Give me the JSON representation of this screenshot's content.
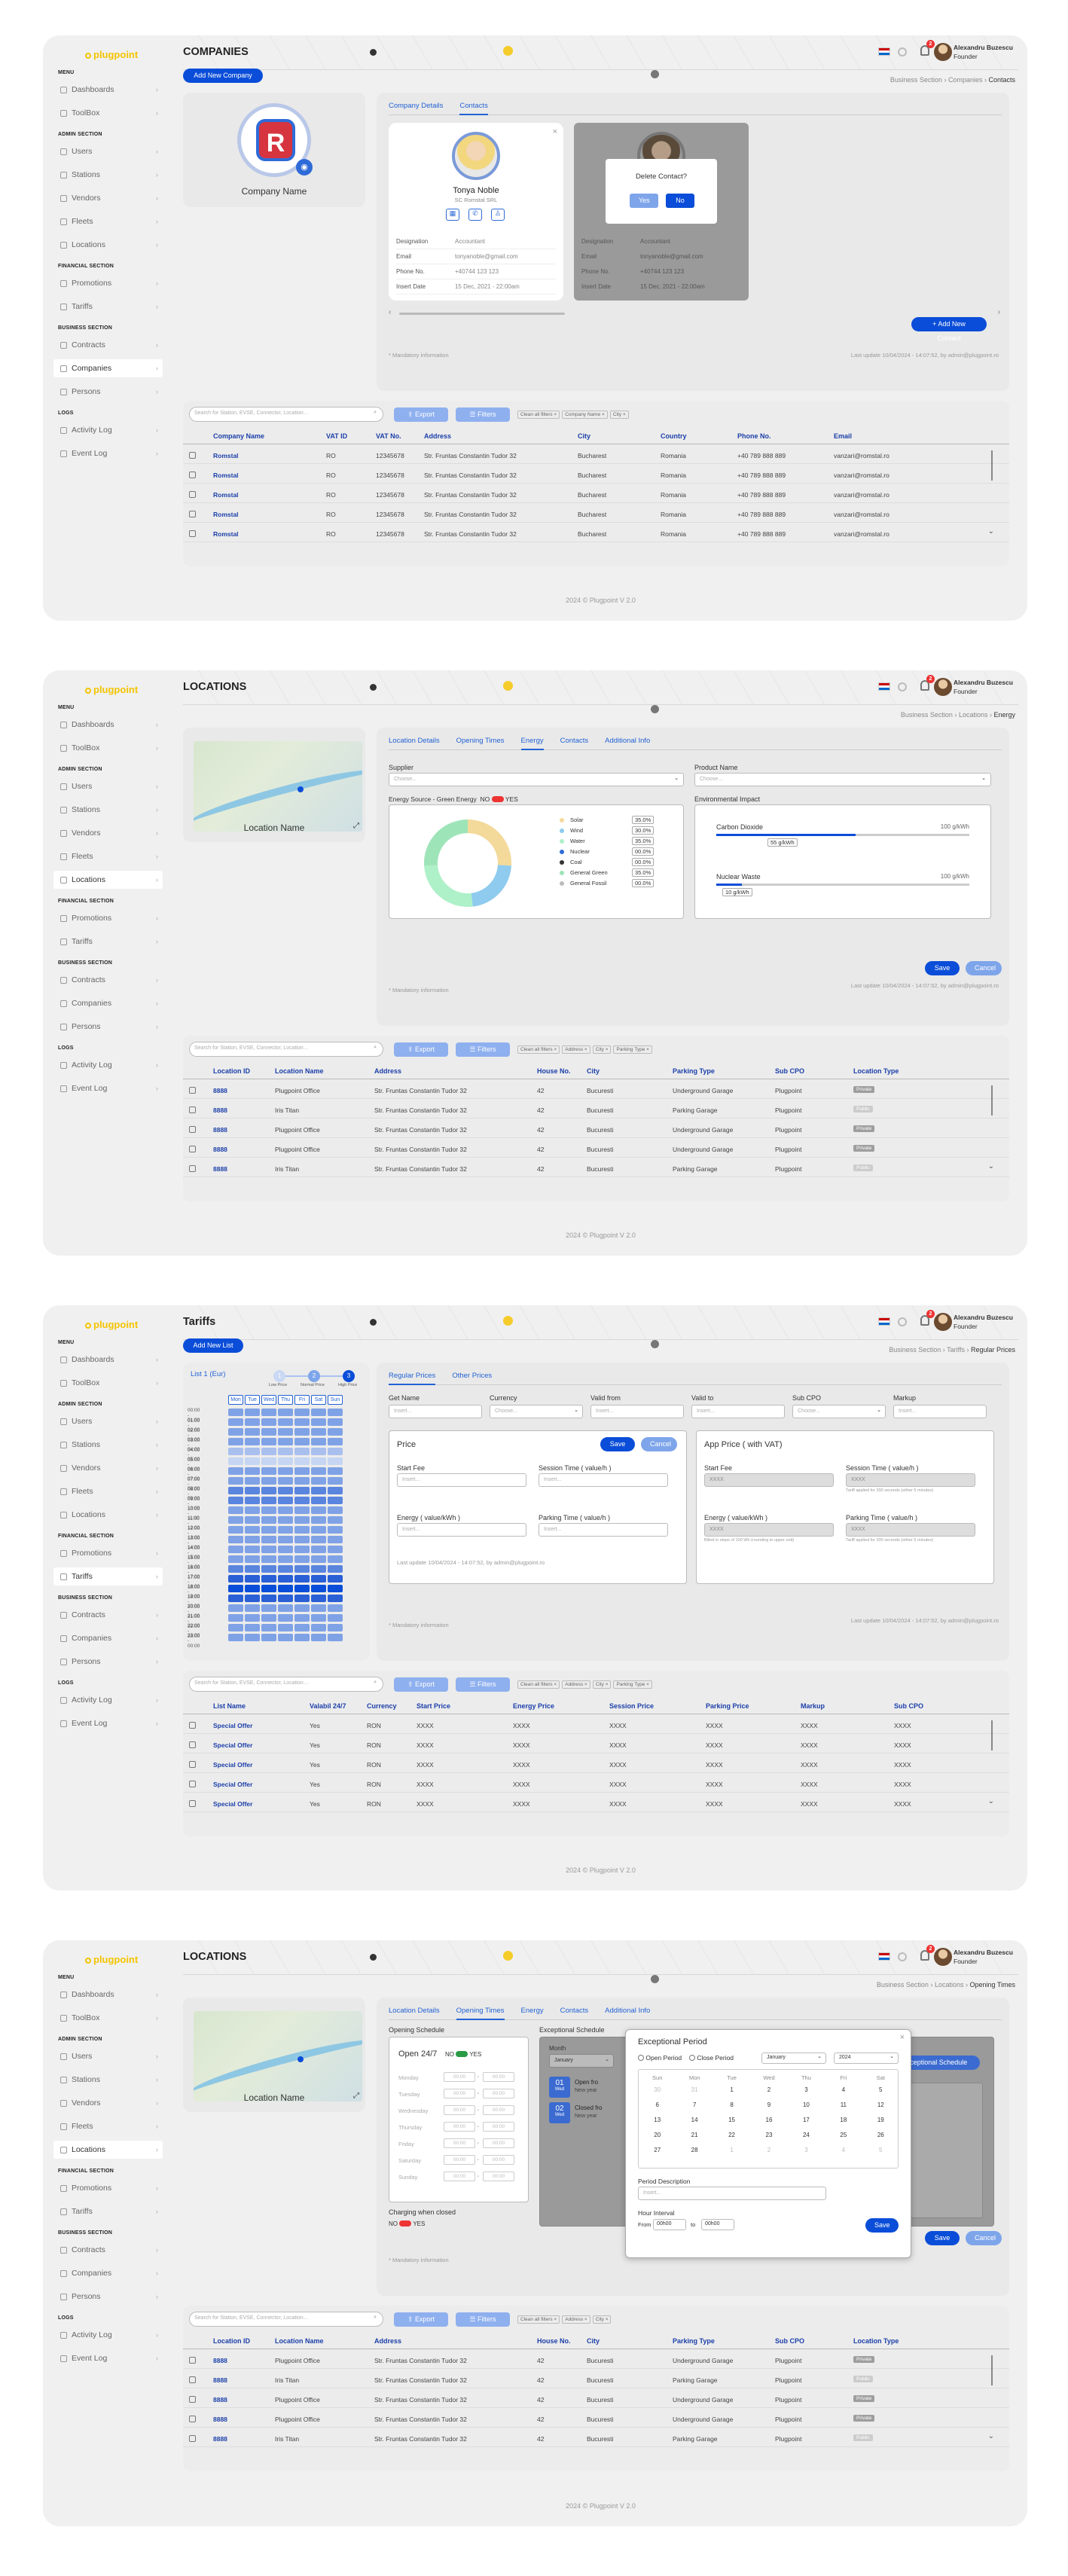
{
  "brand": "plugpoint",
  "user": {
    "name": "Alexandru Buzescu",
    "role": "Founder"
  },
  "notif_count": "2",
  "footer": "2024 © Plugpoint V 2.0",
  "sidebar": {
    "menu_header": "MENU",
    "dashboards": "Dashboards",
    "toolbox": "ToolBox",
    "admin_header": "ADMIN SECTION",
    "users": "Users",
    "stations": "Stations",
    "vendors": "Vendors",
    "fleets": "Fleets",
    "locations": "Locations",
    "financial_header": "FINANCIAL SECTION",
    "promotions": "Promotions",
    "tariffs": "Tariffs",
    "business_header": "BUSINESS SECTION",
    "contracts": "Contracts",
    "companies": "Companies",
    "persons": "Persons",
    "logs_header": "LOGS",
    "activity_log": "Activity Log",
    "event_log": "Event Log"
  },
  "screen1": {
    "title": "COMPANIES",
    "add_button": "Add New Company",
    "crumb": [
      "Business Section",
      "Companies",
      "Contacts"
    ],
    "company_name": "Company Name",
    "tabs": [
      "Company Details",
      "Contacts"
    ],
    "contact": {
      "name": "Tonya Noble",
      "company": "SC Romstal SRL",
      "fields": [
        [
          "Designation",
          "Accountant"
        ],
        [
          "Email",
          "tonyanoble@gmail.com"
        ],
        [
          "Phone No.",
          "+40744 123 123"
        ],
        [
          "Insert Date",
          "15 Dec, 2021 - 22:00am"
        ]
      ]
    },
    "delete_dialog": {
      "title": "Delete Contact?",
      "yes": "Yes",
      "no": "No"
    },
    "add_contact": "+ Add New Contact",
    "mandatory": "* Mandatory information",
    "last_update": "Last update 10/04/2024 - 14:07:52, by admin@plugpoint.ro",
    "search_placeholder": "Search for Station, EVSE, Connector, Location…",
    "export": "Export",
    "filters": "Filters",
    "chips": [
      "Clean all filters ×",
      "Company Name ×",
      "City ×"
    ],
    "columns": [
      "Company Name",
      "VAT ID",
      "VAT No.",
      "Address",
      "City",
      "Country",
      "Phone No.",
      "Email"
    ],
    "rows": [
      [
        "Romstal",
        "RO",
        "12345678",
        "Str. Fruntas Constantin Tudor 32",
        "Bucharest",
        "Romania",
        "+40 789 888 889",
        "vanzari@romstal.ro"
      ],
      [
        "Romstal",
        "RO",
        "12345678",
        "Str. Fruntas Constantin Tudor 32",
        "Bucharest",
        "Romania",
        "+40 789 888 889",
        "vanzari@romstal.ro"
      ],
      [
        "Romstal",
        "RO",
        "12345678",
        "Str. Fruntas Constantin Tudor 32",
        "Bucharest",
        "Romania",
        "+40 789 888 889",
        "vanzari@romstal.ro"
      ],
      [
        "Romstal",
        "RO",
        "12345678",
        "Str. Fruntas Constantin Tudor 32",
        "Bucharest",
        "Romania",
        "+40 789 888 889",
        "vanzari@romstal.ro"
      ],
      [
        "Romstal",
        "RO",
        "12345678",
        "Str. Fruntas Constantin Tudor 32",
        "Bucharest",
        "Romania",
        "+40 789 888 889",
        "vanzari@romstal.ro"
      ]
    ]
  },
  "screen2": {
    "title": "LOCATIONS",
    "crumb": [
      "Business Section",
      "Locations",
      "Energy"
    ],
    "location_name": "Location Name",
    "tabs": [
      "Location Details",
      "Opening Times",
      "Energy",
      "Contacts",
      "Additional Info"
    ],
    "supplier_label": "Supplier",
    "supplier_placeholder": "Choose...",
    "product_label": "Product Name",
    "product_placeholder": "Choose...",
    "energy_source": "Energy Source - Green Energy",
    "no": "NO",
    "yes": "YES",
    "legend": [
      [
        "Solar",
        "35.0%",
        "#f3d99a"
      ],
      [
        "Wind",
        "30.0%",
        "#8ecbee"
      ],
      [
        "Water",
        "35.0%",
        "#aef0c8"
      ],
      [
        "Nuclear",
        "00.0%",
        "#2f6bd8"
      ],
      [
        "Coal",
        "00.0%",
        "#333333"
      ],
      [
        "General Green",
        "35.0%",
        "#9ee4b9"
      ],
      [
        "General Fossil",
        "00.0%",
        "#bbbbbb"
      ]
    ],
    "env_label": "Environmental Impact",
    "carbon": {
      "label": "Carbon Dioxide",
      "max": "100 g/kWh",
      "value": "55 g/kWh",
      "fraction": 0.55
    },
    "waste": {
      "label": "Nuclear Waste",
      "max": "100 g/kWh",
      "value": "10 g/kWh",
      "fraction": 0.1
    },
    "save": "Save",
    "cancel": "Cancel",
    "mandatory": "* Mandatory information",
    "last_update": "Last update 10/04/2024 - 14:07:52, by admin@plugpoint.ro",
    "search_placeholder": "Search for Station, EVSE, Connector, Location…",
    "export": "Export",
    "filters": "Filters",
    "chips": [
      "Clean all filters ×",
      "Address ×",
      "City ×",
      "Parking Type ×"
    ],
    "columns": [
      "Location ID",
      "Location Name",
      "Address",
      "House No.",
      "City",
      "Parking Type",
      "Sub CPO",
      "Location Type"
    ],
    "rows": [
      [
        "8888",
        "Plugpoint Office",
        "Str. Fruntas Constantin Tudor 32",
        "42",
        "Bucuresti",
        "Underground Garage",
        "Plugpoint",
        "Private"
      ],
      [
        "8888",
        "Iris Titan",
        "Str. Fruntas Constantin Tudor 32",
        "42",
        "Bucuresti",
        "Parking Garage",
        "Plugpoint",
        "Public"
      ],
      [
        "8888",
        "Plugpoint Office",
        "Str. Fruntas Constantin Tudor 32",
        "42",
        "Bucuresti",
        "Underground Garage",
        "Plugpoint",
        "Private"
      ],
      [
        "8888",
        "Plugpoint Office",
        "Str. Fruntas Constantin Tudor 32",
        "42",
        "Bucuresti",
        "Underground Garage",
        "Plugpoint",
        "Private"
      ],
      [
        "8888",
        "Iris Titan",
        "Str. Fruntas Constantin Tudor 32",
        "42",
        "Bucuresti",
        "Parking Garage",
        "Plugpoint",
        "Public"
      ]
    ]
  },
  "screen3": {
    "title": "Tariffs",
    "add_button": "Add New List",
    "crumb": [
      "Business Section",
      "Tariffs",
      "Regular Prices"
    ],
    "list_title": "List 1 (Eur)",
    "price_levels": [
      "Low Price",
      "Normal Price",
      "High Price"
    ],
    "days": [
      "Mon",
      "Tue",
      "Wed",
      "Thu",
      "Fri",
      "Sat",
      "Sun"
    ],
    "hours": [
      "00:00 - 01:00",
      "01:00 - 02:00",
      "02:00 - 03:00",
      "03:00 - 04:00",
      "04:00 - 05:00",
      "05:00 - 06:00",
      "06:00 - 07:00",
      "07:00 - 08:00",
      "08:00 - 09:00",
      "09:00 - 10:00",
      "10:00 - 11:00",
      "11:00 - 12:00",
      "12:00 - 13:00",
      "13:00 - 14:00",
      "14:00 - 15:00",
      "15:00 - 16:00",
      "16:00 - 17:00",
      "17:00 - 18:00",
      "18:00 - 19:00",
      "19:00 - 20:00",
      "20:00 - 21:00",
      "21:00 - 22:00",
      "22:00 - 23:00",
      "23:00 - 00:00"
    ],
    "tabs": [
      "Regular Prices",
      "Other Prices"
    ],
    "fields": [
      "Get Name",
      "Currency",
      "Valid from",
      "Valid to",
      "Sub CPO",
      "Markup"
    ],
    "field_placeholders": [
      "Insert...",
      "Choose...",
      "Insert...",
      "Insert...",
      "Choose...",
      "Insert..."
    ],
    "price_title": "Price",
    "save": "Save",
    "cancel": "Cancel",
    "start_fee": "Start Fee",
    "session_time": "Session Time ( value/h )",
    "energy": "Energy ( value/kWh )",
    "parking_time": "Parking Time ( value/h )",
    "insert": "Insert...",
    "app_price_title": "App Price ( with VAT)",
    "app_values": [
      "XXXX",
      "XXXX",
      "XXXX",
      "XXXX"
    ],
    "tariff_note": "Tariff applied for 300 seconds (either 5 minutes)",
    "billed_note": "Billed in steps of 100 Wh (rounding to upper unit)",
    "price_update": "Last update 10/04/2024 - 14:07:52, by admin@plugpoint.ro",
    "mandatory": "* Mandatory information",
    "last_update": "Last update 10/04/2024 - 14:07:52, by admin@plugpoint.ro",
    "search_placeholder": "Search for Station, EVSE, Connector, Location…",
    "export": "Export",
    "filters": "Filters",
    "chips": [
      "Clean all filters ×",
      "Address ×",
      "City ×",
      "Parking Type ×"
    ],
    "columns": [
      "List Name",
      "Valabil 24/7",
      "Currency",
      "Start Price",
      "Energy Price",
      "Session Price",
      "Parking Price",
      "Markup",
      "Sub CPO"
    ],
    "rows": [
      [
        "Special Offer",
        "Yes",
        "RON",
        "XXXX",
        "XXXX",
        "XXXX",
        "XXXX",
        "XXXX",
        "XXXX"
      ],
      [
        "Special Offer",
        "Yes",
        "RON",
        "XXXX",
        "XXXX",
        "XXXX",
        "XXXX",
        "XXXX",
        "XXXX"
      ],
      [
        "Special Offer",
        "Yes",
        "RON",
        "XXXX",
        "XXXX",
        "XXXX",
        "XXXX",
        "XXXX",
        "XXXX"
      ],
      [
        "Special Offer",
        "Yes",
        "RON",
        "XXXX",
        "XXXX",
        "XXXX",
        "XXXX",
        "XXXX",
        "XXXX"
      ],
      [
        "Special Offer",
        "Yes",
        "RON",
        "XXXX",
        "XXXX",
        "XXXX",
        "XXXX",
        "XXXX",
        "XXXX"
      ]
    ]
  },
  "screen4": {
    "title": "LOCATIONS",
    "crumb": [
      "Business Section",
      "Locations",
      "Opening Times"
    ],
    "location_name": "Location Name",
    "tabs": [
      "Location Details",
      "Opening Times",
      "Energy",
      "Contacts",
      "Additional Info"
    ],
    "opening_schedule": "Opening Schedule",
    "open247": "Open 24/7",
    "no": "NO",
    "yes": "YES",
    "weekdays": [
      "Monday",
      "Tuesday",
      "Wednesday",
      "Thursday",
      "Friday",
      "Saturday",
      "Sunday"
    ],
    "time_ph": "00:00",
    "charging_closed": "Charging when closed",
    "exceptional_schedule": "Exceptional Schedule",
    "month_label": "Month",
    "month_value": "January",
    "exc_items": [
      [
        "01",
        "Wed",
        "Open fro",
        "New year"
      ],
      [
        "02",
        "Wed",
        "Closed fro",
        "New year"
      ]
    ],
    "add_exc": "Exceptional Schedule",
    "dialog": {
      "title": "Exceptional Period",
      "open": "Open Period",
      "close": "Close Period",
      "month": "January",
      "year": "2024",
      "days_header": [
        "Sun",
        "Mon",
        "Tue",
        "Wed",
        "Thu",
        "Fri",
        "Sat"
      ],
      "dates": [
        "30",
        "31",
        "1",
        "2",
        "3",
        "4",
        "5",
        "6",
        "7",
        "8",
        "9",
        "10",
        "11",
        "12",
        "13",
        "14",
        "15",
        "16",
        "17",
        "18",
        "19",
        "20",
        "21",
        "22",
        "23",
        "24",
        "25",
        "26",
        "27",
        "28",
        "1",
        "2",
        "3",
        "4",
        "5"
      ],
      "period_desc": "Period Description",
      "desc_ph": "Insert...",
      "hour_interval": "Hour Interval",
      "from": "From",
      "to": "to",
      "from_val": "00h00",
      "to_val": "00h00",
      "save": "Save"
    },
    "save": "Save",
    "cancel": "Cancel",
    "mandatory": "* Mandatory information",
    "search_placeholder": "Search for Station, EVSE, Connector, Location…",
    "export": "Export",
    "filters": "Filters",
    "chips": [
      "Clean all filters ×",
      "Address ×",
      "City ×"
    ],
    "columns": [
      "Location ID",
      "Location Name",
      "Address",
      "House No.",
      "City",
      "Parking Type",
      "Sub CPO",
      "Location Type"
    ],
    "rows": [
      [
        "8888",
        "Plugpoint Office",
        "Str. Fruntas Constantin Tudor 32",
        "42",
        "Bucuresti",
        "Underground Garage",
        "Plugpoint",
        "Private"
      ],
      [
        "8888",
        "Iris Titan",
        "Str. Fruntas Constantin Tudor 32",
        "42",
        "Bucuresti",
        "Parking Garage",
        "Plugpoint",
        "Public"
      ],
      [
        "8888",
        "Plugpoint Office",
        "Str. Fruntas Constantin Tudor 32",
        "42",
        "Bucuresti",
        "Underground Garage",
        "Plugpoint",
        "Private"
      ],
      [
        "8888",
        "Plugpoint Office",
        "Str. Fruntas Constantin Tudor 32",
        "42",
        "Bucuresti",
        "Underground Garage",
        "Plugpoint",
        "Private"
      ],
      [
        "8888",
        "Iris Titan",
        "Str. Fruntas Constantin Tudor 32",
        "42",
        "Bucuresti",
        "Parking Garage",
        "Plugpoint",
        "Public"
      ]
    ]
  }
}
